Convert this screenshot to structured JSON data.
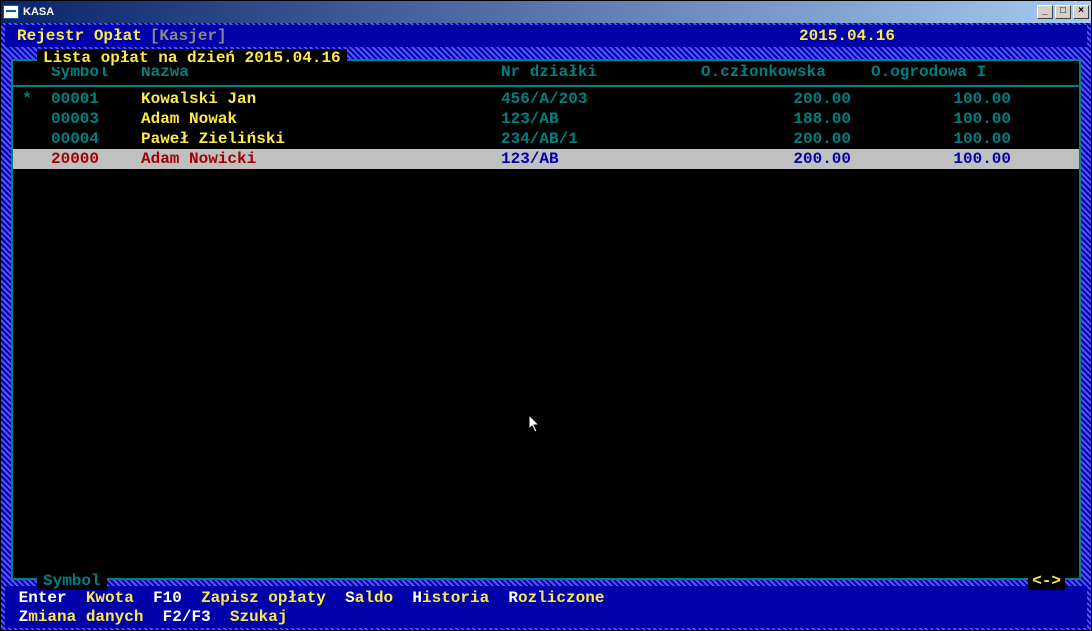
{
  "window": {
    "title": "KASA",
    "min": "_",
    "max": "□",
    "close": "×"
  },
  "header": {
    "title": "Rejestr Opłat",
    "role": "[Kasjer]",
    "date": "2015.04.16"
  },
  "panel": {
    "title": " Lista opłat na dzień 2015.04.16 ",
    "columns": {
      "symbol": "Symbol",
      "name": "Nazwa",
      "plot": "Nr działki",
      "member": "O.członkowska",
      "garden": "O.ogrodowa I"
    },
    "footer_label": " Symbol ",
    "footer_arrows": "<->"
  },
  "rows": [
    {
      "mark": "*",
      "symbol": "00001",
      "name": "Kowalski Jan",
      "plot": "456/A/203",
      "member": "200.00",
      "garden": "100.00",
      "selected": false
    },
    {
      "mark": "",
      "symbol": "00003",
      "name": "Adam Nowak",
      "plot": "123/AB",
      "member": "188.00",
      "garden": "100.00",
      "selected": false
    },
    {
      "mark": "",
      "symbol": "00004",
      "name": "Paweł Zieliński",
      "plot": "234/AB/1",
      "member": "200.00",
      "garden": "100.00",
      "selected": false
    },
    {
      "mark": "",
      "symbol": "20000",
      "name": "Adam Nowicki",
      "plot": "123/AB",
      "member": "200.00",
      "garden": "100.00",
      "selected": true
    }
  ],
  "footer": {
    "items": [
      {
        "key": "Enter",
        "label": "Kwota"
      },
      {
        "key": "F10",
        "label": "Zapisz opłaty"
      },
      {
        "key": "S",
        "label": "aldo"
      },
      {
        "key": "H",
        "label": "istoria"
      },
      {
        "key": "R",
        "label": "ozliczone"
      },
      {
        "key": "Z",
        "label": "miana danych"
      },
      {
        "key": "F2/F3",
        "label": "Szukaj"
      }
    ]
  }
}
